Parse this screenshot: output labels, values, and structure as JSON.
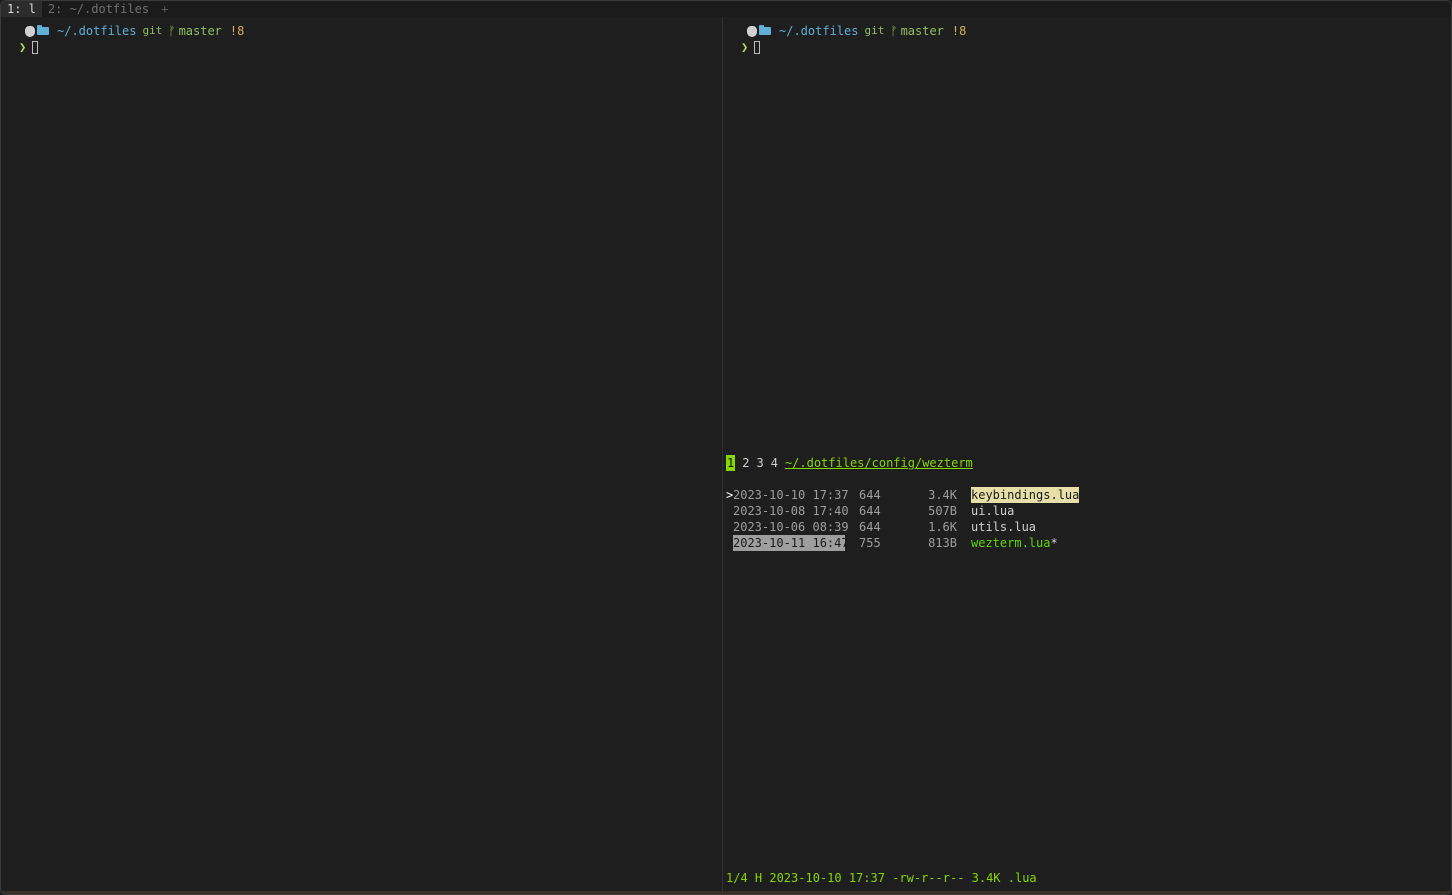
{
  "tabs": [
    {
      "label": "1: l",
      "active": true
    },
    {
      "label": "2: ~/.dotfiles",
      "active": false
    }
  ],
  "tab_add_label": "+",
  "left_pane": {
    "prompt": {
      "path": "~/.dotfiles",
      "vcs": "git",
      "branch": "master",
      "status": "!8"
    },
    "input_symbol": "❯"
  },
  "right_pane": {
    "prompt": {
      "path": "~/.dotfiles",
      "vcs": "git",
      "branch": "master",
      "status": "!8"
    },
    "input_symbol": "❯",
    "file_manager": {
      "tabs": [
        "1",
        "2",
        "3",
        "4"
      ],
      "active_tab": "1",
      "path": "~/.dotfiles/config/wezterm",
      "files": [
        {
          "cursor": ">",
          "date": "2023-10-10 17:37",
          "perm": "644",
          "size": "3.4K",
          "name": "keybindings.lua",
          "suffix": ""
        },
        {
          "cursor": "",
          "date": "2023-10-08 17:40",
          "perm": "644",
          "size": "507B",
          "name": "ui.lua",
          "suffix": ""
        },
        {
          "cursor": "",
          "date": "2023-10-06 08:39",
          "perm": "644",
          "size": "1.6K",
          "name": "utils.lua",
          "suffix": ""
        },
        {
          "cursor": "",
          "date": "2023-10-11 16:47",
          "perm": "755",
          "size": "813B",
          "name": "wezterm.lua",
          "suffix": "*"
        }
      ],
      "status_line": "1/4 H 2023-10-10 17:37 -rw-r--r-- 3.4K .lua"
    }
  },
  "icons": {
    "apple": "apple-icon",
    "folder": "folder-icon",
    "branch": "git-branch-icon"
  },
  "colors": {
    "background": "#1e1e1e",
    "path": "#5fafd7",
    "git": "#8fbf5f",
    "dirty": "#d7af5f",
    "accent_green": "#87d700",
    "selection": "#e6dfa8"
  }
}
